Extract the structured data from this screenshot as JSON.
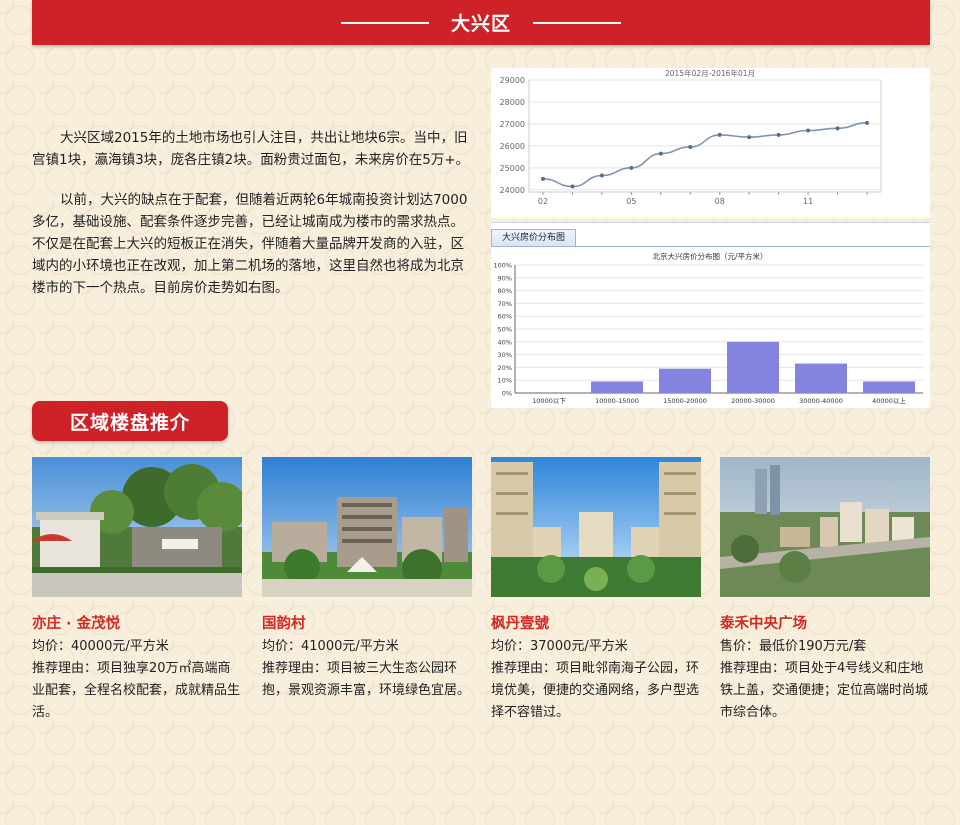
{
  "banner": {
    "title": "大兴区"
  },
  "intro": {
    "paragraph1": "大兴区域2015年的土地市场也引人注目，共出让地块6宗。当中，旧宫镇1块，瀛海镇3块，庞各庄镇2块。面粉贵过面包，未来房价在5万+。",
    "paragraph2": "以前，大兴的缺点在于配套，但随着近两轮6年城南投资计划达7000多亿，基础设施、配套条件逐步完善，已经让城南成为楼市的需求热点。不仅是在配套上大兴的短板正在消失，伴随着大量品牌开发商的入驻，区域内的小环境也正在改观，加上第二机场的落地，这里自然也将成为北京楼市的下一个热点。目前房价走势如右图。"
  },
  "chart_data": [
    {
      "type": "line",
      "title": "2015年02月-2016年01月",
      "x": [
        "02",
        "03",
        "04",
        "05",
        "06",
        "07",
        "08",
        "09",
        "10",
        "11",
        "12",
        "01"
      ],
      "x_tick_labels": [
        "02",
        "05",
        "08",
        "11"
      ],
      "values": [
        24500,
        24150,
        24650,
        25000,
        25650,
        25950,
        26500,
        26400,
        26500,
        26700,
        26800,
        27050
      ],
      "ylim": [
        23900,
        29000
      ],
      "y_ticks": [
        24000,
        25000,
        26000,
        27000,
        28000,
        29000
      ],
      "grid": true,
      "line_color": "#7f93b0"
    },
    {
      "type": "bar",
      "tab_label": "大兴房价分布图",
      "title": "北京大兴房价分布图（元/平方米）",
      "categories": [
        "10000以下",
        "10000-15000",
        "15000-20000",
        "20000-30000",
        "30000-40000",
        "40000以上"
      ],
      "values": [
        0,
        9,
        19,
        40,
        23,
        9
      ],
      "ylim": [
        0,
        100
      ],
      "y_tick_labels": [
        "0%",
        "10%",
        "20%",
        "30%",
        "40%",
        "50%",
        "60%",
        "70%",
        "80%",
        "90%",
        "100%"
      ],
      "bar_color": "#8484e0"
    }
  ],
  "section": {
    "title": "区域楼盘推介"
  },
  "listings": [
    {
      "name": "亦庄 · 金茂悦",
      "price": "均价：40000元/平方米",
      "reason": "推荐理由：项目独享20万㎡高端商业配套，全程名校配套，成就精品生活。"
    },
    {
      "name": "国韵村",
      "price": "均价：41000元/平方米",
      "reason": "推荐理由：项目被三大生态公园环抱，景观资源丰富，环境绿色宜居。"
    },
    {
      "name": "枫丹壹號",
      "price": "均价：37000元/平方米",
      "reason": "推荐理由：项目毗邻南海子公园，环境优美，便捷的交通网络，多户型选择不容错过。"
    },
    {
      "name": "泰禾中央广场",
      "price": "售价：最低价190万元/套",
      "reason": "推荐理由：项目处于4号线义和庄地铁上盖，交通便捷；定位高端时尚城市综合体。"
    }
  ]
}
